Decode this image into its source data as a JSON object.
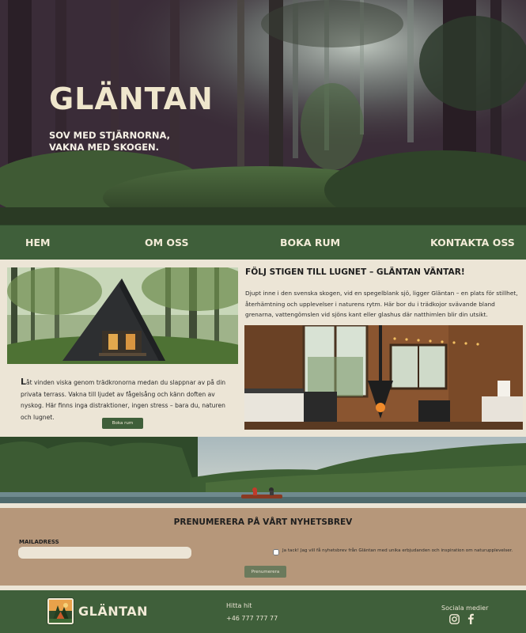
{
  "hero": {
    "title": "GLÄNTAN",
    "tagline_line1": "SOV MED STJÄRNORNA,",
    "tagline_line2": "VAKNA MED SKOGEN."
  },
  "nav": {
    "items": [
      {
        "label": "HEM"
      },
      {
        "label": "OM OSS"
      },
      {
        "label": "BOKA RUM"
      },
      {
        "label": "KONTAKTA OSS"
      }
    ]
  },
  "content": {
    "intro_first_letter": "L",
    "intro_rest": "åt vinden viska genom trädkronorna medan du slappnar av på din privata terrass. Vakna till ljudet av fågelsång och känn doften av nyskog. Här finns inga distraktioner, ingen stress – bara du, naturen och lugnet.",
    "book_button": "Boka rum",
    "heading": "FÖLJ STIGEN TILL LUGNET – GLÄNTAN VÄNTAR!",
    "paragraph": "Djupt inne i den svenska skogen, vid en spegelblank sjö, ligger Gläntan – en plats för stillhet, återhämtning och upplevelser i naturens rytm. Här bor du i trädkojor svävande bland grenarna, vattengömslen vid sjöns kant eller glashus där natthimlen blir din utsikt."
  },
  "newsletter": {
    "title": "PRENUMERERA PÅ VÅRT NYHETSBREV",
    "email_label": "MAILADRESS",
    "email_placeholder": "",
    "consent": "Ja tack! Jag vill få nyhetsbrev från Gläntan med unika erbjudanden och inspiration om naturupplevelser.",
    "subscribe_button": "Prenumerera"
  },
  "footer": {
    "logo_text": "GLÄNTAN",
    "find_label": "Hitta hit",
    "phone": "+46 777 777 77",
    "social_label": "Sociala medier",
    "social_icons": [
      "instagram-icon",
      "facebook-icon"
    ]
  },
  "colors": {
    "forest_green": "#3f5f3a",
    "cream": "#ece5d6",
    "tan": "#b6977a"
  }
}
